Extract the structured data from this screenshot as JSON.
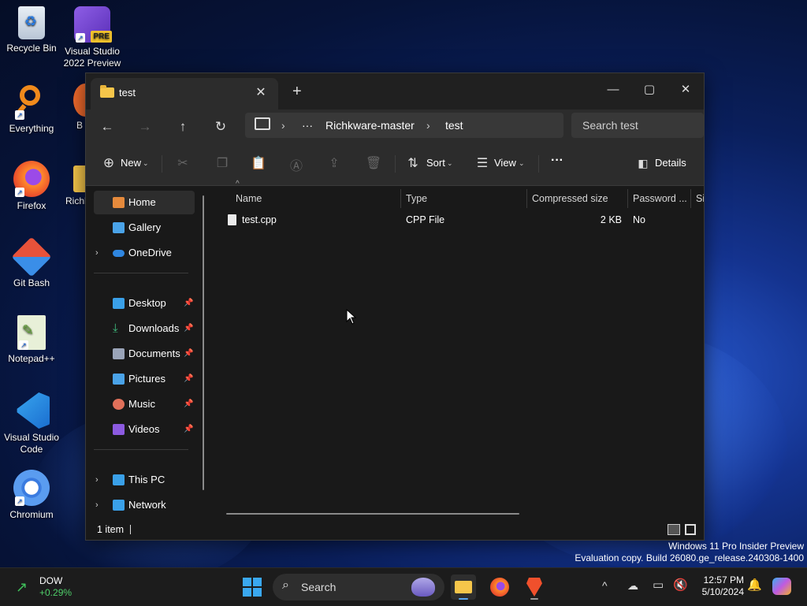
{
  "desktop": {
    "icons": [
      {
        "label": "Recycle Bin"
      },
      {
        "label": "Visual Studio 2022 Preview",
        "badge": "PRE"
      },
      {
        "label": "Everything"
      },
      {
        "label": "B"
      },
      {
        "label": "Firefox"
      },
      {
        "label": "Richk"
      },
      {
        "label": "Git Bash"
      },
      {
        "label": "Notepad++"
      },
      {
        "label": "Visual Studio Code"
      },
      {
        "label": "Chromium"
      }
    ],
    "watermark": {
      "line1": "Windows 11 Pro Insider Preview",
      "line2": "Evaluation copy. Build 26080.ge_release.240308-1400"
    }
  },
  "window": {
    "tab_title": "test",
    "tab_close": "✕",
    "new_tab": "+",
    "controls": {
      "minimize": "—",
      "maximize": "▢",
      "close": "✕"
    },
    "nav": {
      "back": "←",
      "forward": "→",
      "up": "↑",
      "refresh": "↻"
    },
    "address": {
      "ellipsis": "···",
      "sep": "›",
      "crumbs": [
        "Richkware-master",
        "test"
      ]
    },
    "search_placeholder": "Search test",
    "toolbar": {
      "new_label": "New",
      "sort_label": "Sort",
      "view_label": "View",
      "more": "···",
      "details_label": "Details"
    },
    "sidebar": {
      "top": [
        {
          "label": "Home",
          "color": "#e58a3c"
        },
        {
          "label": "Gallery",
          "color": "#4aa3e8"
        },
        {
          "label": "OneDrive",
          "color": "#2f86e0"
        }
      ],
      "pinned": [
        {
          "label": "Desktop",
          "color": "#3aa0e8"
        },
        {
          "label": "Downloads",
          "color": "#3fbf7f"
        },
        {
          "label": "Documents",
          "color": "#9aa4b8"
        },
        {
          "label": "Pictures",
          "color": "#4aa3e8"
        },
        {
          "label": "Music",
          "color": "#e0705a"
        },
        {
          "label": "Videos",
          "color": "#8c5ae0"
        }
      ],
      "bottom": [
        {
          "label": "This PC",
          "color": "#3aa0e8"
        },
        {
          "label": "Network",
          "color": "#3aa0e8"
        }
      ]
    },
    "columns": [
      "Name",
      "Type",
      "Compressed size",
      "Password ...",
      "Si"
    ],
    "files": [
      {
        "name": "test.cpp",
        "type": "CPP File",
        "size": "2 KB",
        "password": "No"
      }
    ],
    "status": "1 item"
  },
  "taskbar": {
    "widget": {
      "title": "DOW",
      "change": "+0.29%"
    },
    "search_placeholder": "Search",
    "time": "12:57 PM",
    "date": "5/10/2024",
    "tray_chevron": "^"
  }
}
